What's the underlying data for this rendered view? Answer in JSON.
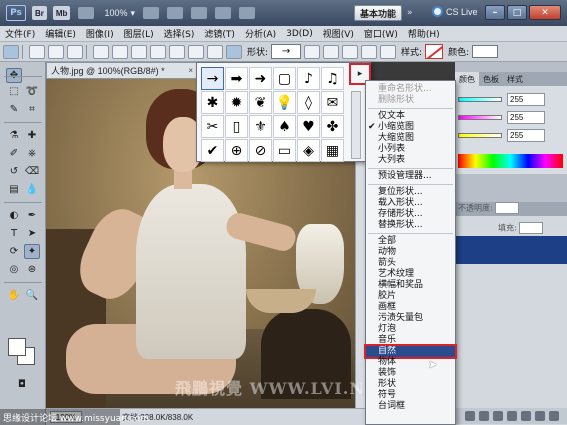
{
  "titlebar": {
    "app_logo": "Ps",
    "br_label": "Br",
    "mb_label": "Mb",
    "zoom": "100%",
    "workspace": "基本功能",
    "cs_live": "CS Live",
    "minimize": "–",
    "maximize": "□",
    "close": "✕"
  },
  "menubar": {
    "items": [
      "文件(F)",
      "编辑(E)",
      "图像(I)",
      "图层(L)",
      "选择(S)",
      "滤镜(T)",
      "分析(A)",
      "3D(D)",
      "视图(V)",
      "窗口(W)",
      "帮助(H)"
    ]
  },
  "options": {
    "shape_label": "形状:",
    "style_label": "样式:",
    "color_label": "颜色:"
  },
  "document": {
    "tab_title": "人物.jpg @ 100%(RGB/8#) *",
    "tab_close": "×",
    "zoom": "100%",
    "doc_size": "文档:838.0K/838.0K",
    "watermark": "飛鵬視覺 WWW.LVI.NET"
  },
  "caption": "思缘设计论坛 www.missyuan.com",
  "shape_picker": {
    "shapes": [
      "→",
      "➡",
      "➜",
      "▢",
      "♪",
      "♫",
      "✱",
      "✹",
      "❦",
      "💡",
      "◊",
      "✉",
      "✂",
      "▯",
      "⚜",
      "♠",
      "♥",
      "✤",
      "✔",
      "⊕",
      "⊘",
      "▭",
      "◈",
      "▦"
    ],
    "menu_button": "▸"
  },
  "panels": {
    "tabs": [
      "颜色",
      "色板",
      "样式"
    ],
    "rgb_values": [
      "255",
      "255",
      "255"
    ],
    "opacity_label": "不透明度:",
    "fill_label": "填充:"
  },
  "dropdown": {
    "items": [
      {
        "label": "重命名形状...",
        "disabled": true
      },
      {
        "label": "删除形状",
        "disabled": true
      },
      {
        "sep": true
      },
      {
        "label": "仅文本"
      },
      {
        "label": "小缩览图",
        "checked": true
      },
      {
        "label": "大缩览图"
      },
      {
        "label": "小列表"
      },
      {
        "label": "大列表"
      },
      {
        "sep": true
      },
      {
        "label": "预设管理器..."
      },
      {
        "sep": true
      },
      {
        "label": "复位形状..."
      },
      {
        "label": "载入形状..."
      },
      {
        "label": "存储形状..."
      },
      {
        "label": "替换形状..."
      },
      {
        "sep": true
      },
      {
        "label": "全部"
      },
      {
        "label": "动物"
      },
      {
        "label": "箭头"
      },
      {
        "label": "艺术纹理"
      },
      {
        "label": "横幅和奖品"
      },
      {
        "label": "胶片"
      },
      {
        "label": "画框"
      },
      {
        "label": "污渍矢量包"
      },
      {
        "label": "灯泡"
      },
      {
        "label": "音乐"
      },
      {
        "label": "自然",
        "highlighted": true
      },
      {
        "label": "物体"
      },
      {
        "label": "装饰"
      },
      {
        "label": "形状"
      },
      {
        "label": "符号"
      },
      {
        "label": "台词框"
      }
    ]
  }
}
